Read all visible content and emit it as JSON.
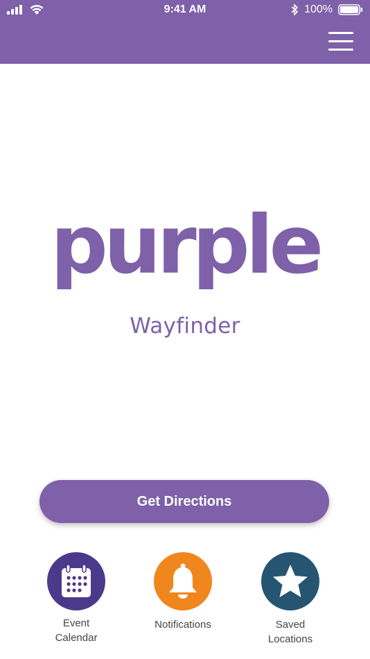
{
  "status_bar": {
    "time": "9:41 AM",
    "battery_percent": "100%"
  },
  "header": {
    "menu_icon": "hamburger-menu-icon"
  },
  "brand": {
    "logo_text": "purple",
    "subtitle": "Wayfinder"
  },
  "actions": {
    "get_directions_label": "Get Directions"
  },
  "shortcuts": [
    {
      "label": "Event Calendar",
      "icon": "calendar-icon",
      "color": "#4b3a8c"
    },
    {
      "label": "Notifications",
      "icon": "bell-icon",
      "color": "#f0861e"
    },
    {
      "label": "Saved Locations",
      "icon": "star-icon",
      "color": "#255571"
    }
  ],
  "colors": {
    "brand_purple": "#7e61a9"
  }
}
